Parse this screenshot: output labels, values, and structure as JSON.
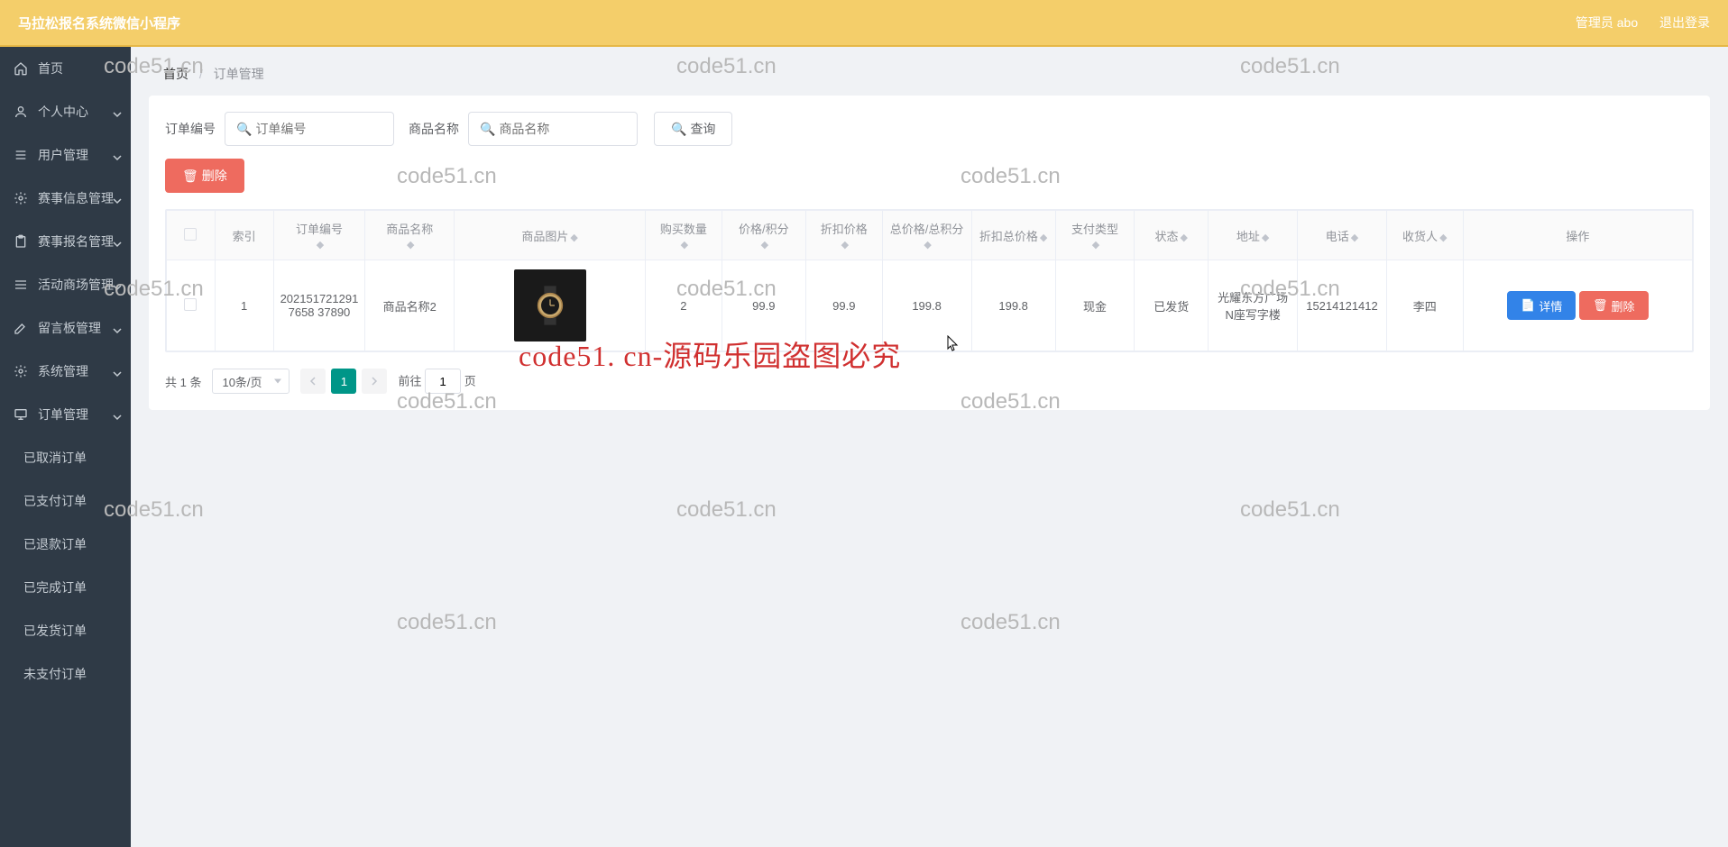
{
  "header": {
    "title": "马拉松报名系统微信小程序",
    "user_label": "管理员 abo",
    "logout_label": "退出登录"
  },
  "sidebar": {
    "items": [
      {
        "label": "首页",
        "icon": "home",
        "expandable": false
      },
      {
        "label": "个人中心",
        "icon": "user",
        "expandable": true
      },
      {
        "label": "用户管理",
        "icon": "list",
        "expandable": true
      },
      {
        "label": "赛事信息管理",
        "icon": "gear",
        "expandable": true
      },
      {
        "label": "赛事报名管理",
        "icon": "clipboard",
        "expandable": true
      },
      {
        "label": "活动商场管理",
        "icon": "grid",
        "expandable": true
      },
      {
        "label": "留言板管理",
        "icon": "edit",
        "expandable": true
      },
      {
        "label": "系统管理",
        "icon": "gear",
        "expandable": true
      },
      {
        "label": "订单管理",
        "icon": "monitor",
        "expandable": true
      }
    ],
    "sub_items": [
      {
        "label": "已取消订单"
      },
      {
        "label": "已支付订单"
      },
      {
        "label": "已退款订单"
      },
      {
        "label": "已完成订单"
      },
      {
        "label": "已发货订单"
      },
      {
        "label": "未支付订单"
      }
    ]
  },
  "breadcrumb": {
    "home": "首页",
    "current": "订单管理"
  },
  "search": {
    "order_no_label": "订单编号",
    "order_no_placeholder": "订单编号",
    "product_name_label": "商品名称",
    "product_name_placeholder": "商品名称",
    "query_label": "查询"
  },
  "actions": {
    "delete_label": "删除"
  },
  "table": {
    "headers": {
      "index": "索引",
      "order_no": "订单编号",
      "product_name": "商品名称",
      "product_image": "商品图片",
      "buy_qty": "购买数量",
      "price": "价格/积分",
      "discount_price": "折扣价格",
      "total_price": "总价格/总积分",
      "discount_total": "折扣总价格",
      "pay_type": "支付类型",
      "status": "状态",
      "address": "地址",
      "phone": "电话",
      "recipient": "收货人",
      "action": "操作"
    },
    "rows": [
      {
        "index": "1",
        "order_no": "2021517212917658 37890",
        "product_name": "商品名称2",
        "buy_qty": "2",
        "price": "99.9",
        "discount_price": "99.9",
        "total_price": "199.8",
        "discount_total": "199.8",
        "pay_type": "现金",
        "status": "已发货",
        "address": "光耀东方广场N座写字楼",
        "phone": "15214121412",
        "recipient": "李四",
        "detail_label": "详情",
        "delete_label": "删除"
      }
    ]
  },
  "pagination": {
    "total_text": "共 1 条",
    "page_size_text": "10条/页",
    "current_page": "1",
    "jump_prefix": "前往",
    "jump_input_value": "1",
    "jump_suffix": "页"
  },
  "watermarks": {
    "text": "code51.cn",
    "red_text": "code51. cn-源码乐园盗图必究"
  }
}
